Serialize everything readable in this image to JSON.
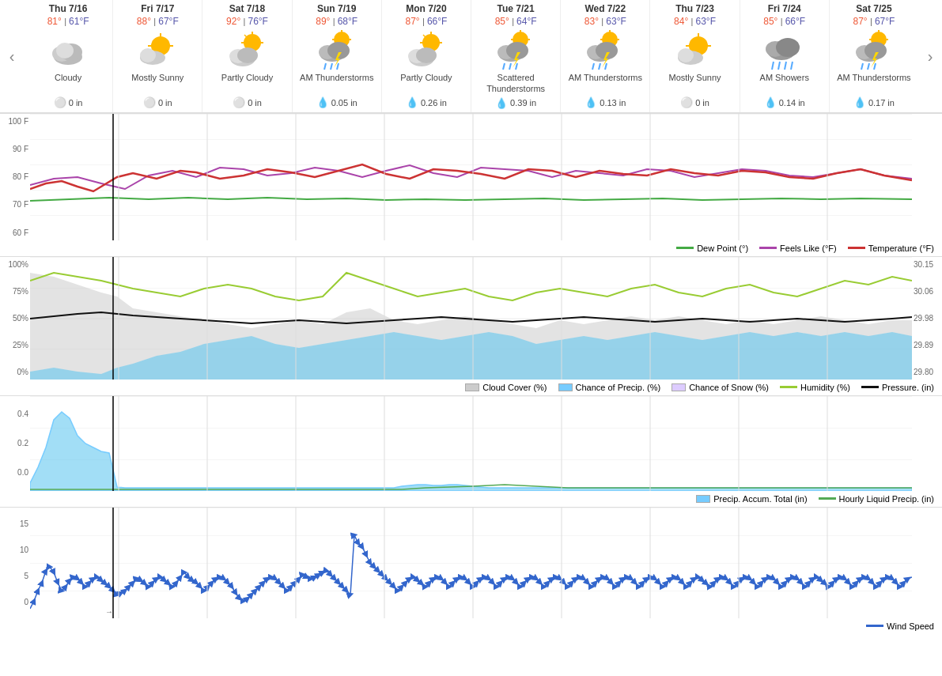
{
  "nav": {
    "left_label": "‹",
    "right_label": "›"
  },
  "days": [
    {
      "label": "Thu 7/16",
      "high": "81°",
      "low": "61°F",
      "icon": "cloudy",
      "desc": "Cloudy",
      "precip_icon": "snow",
      "precip": "0 in"
    },
    {
      "label": "Fri 7/17",
      "high": "88°",
      "low": "67°F",
      "icon": "mostly_sunny",
      "desc": "Mostly Sunny",
      "precip_icon": "snow",
      "precip": "0 in"
    },
    {
      "label": "Sat 7/18",
      "high": "92°",
      "low": "76°F",
      "icon": "partly_cloudy",
      "desc": "Partly Cloudy",
      "precip_icon": "snow",
      "precip": "0 in"
    },
    {
      "label": "Sun 7/19",
      "high": "89°",
      "low": "68°F",
      "icon": "thunderstorm",
      "desc": "AM Thunderstorms",
      "precip_icon": "rain",
      "precip": "0.05 in"
    },
    {
      "label": "Mon 7/20",
      "high": "87°",
      "low": "66°F",
      "icon": "partly_cloudy",
      "desc": "Partly Cloudy",
      "precip_icon": "rain",
      "precip": "0.26 in"
    },
    {
      "label": "Tue 7/21",
      "high": "85°",
      "low": "64°F",
      "icon": "thunderstorm",
      "desc": "Scattered Thunderstorms",
      "precip_icon": "rain",
      "precip": "0.39 in"
    },
    {
      "label": "Wed 7/22",
      "high": "83°",
      "low": "63°F",
      "icon": "thunderstorm",
      "desc": "AM Thunderstorms",
      "precip_icon": "rain",
      "precip": "0.13 in"
    },
    {
      "label": "Thu 7/23",
      "high": "84°",
      "low": "63°F",
      "icon": "mostly_sunny",
      "desc": "Mostly Sunny",
      "precip_icon": "snow",
      "precip": "0 in"
    },
    {
      "label": "Fri 7/24",
      "high": "85°",
      "low": "66°F",
      "icon": "showers",
      "desc": "AM Showers",
      "precip_icon": "rain",
      "precip": "0.14 in"
    },
    {
      "label": "Sat 7/25",
      "high": "87°",
      "low": "67°F",
      "icon": "thunderstorm",
      "desc": "AM Thunderstorms",
      "precip_icon": "rain",
      "precip": "0.17 in"
    }
  ],
  "chart1": {
    "y_labels": [
      "100 F",
      "90 F",
      "80 F",
      "70 F",
      "60 F"
    ],
    "legend": [
      {
        "label": "Dew Point (°)",
        "color": "#4a4",
        "type": "line"
      },
      {
        "label": "Feels Like (°F)",
        "color": "#a4a",
        "type": "line"
      },
      {
        "label": "Temperature (°F)",
        "color": "#c33",
        "type": "line"
      }
    ]
  },
  "chart2": {
    "y_labels_left": [
      "100%",
      "75%",
      "50%",
      "25%",
      "0%"
    ],
    "y_labels_right": [
      "30.15",
      "30.06",
      "29.98",
      "29.89",
      "29.80"
    ],
    "legend": [
      {
        "label": "Cloud Cover (%)",
        "color": "#ccc",
        "type": "area"
      },
      {
        "label": "Chance of Precip. (%)",
        "color": "#7cf",
        "type": "area"
      },
      {
        "label": "Chance of Snow (%)",
        "color": "#dcf",
        "type": "area"
      },
      {
        "label": "Humidity (%)",
        "color": "#9c3",
        "type": "line"
      },
      {
        "label": "Pressure. (in)",
        "color": "#111",
        "type": "line"
      }
    ]
  },
  "chart3": {
    "y_labels": [
      "0.4",
      "0.2",
      "0.0"
    ],
    "legend": [
      {
        "label": "Precip. Accum. Total (in)",
        "color": "#7cf",
        "type": "area"
      },
      {
        "label": "Hourly Liquid Precip. (in)",
        "color": "#5a5",
        "type": "line"
      }
    ]
  },
  "chart4": {
    "y_labels": [
      "15",
      "10",
      "5",
      "0"
    ],
    "legend": [
      {
        "label": "Wind Speed",
        "color": "#36c",
        "type": "line"
      }
    ]
  }
}
